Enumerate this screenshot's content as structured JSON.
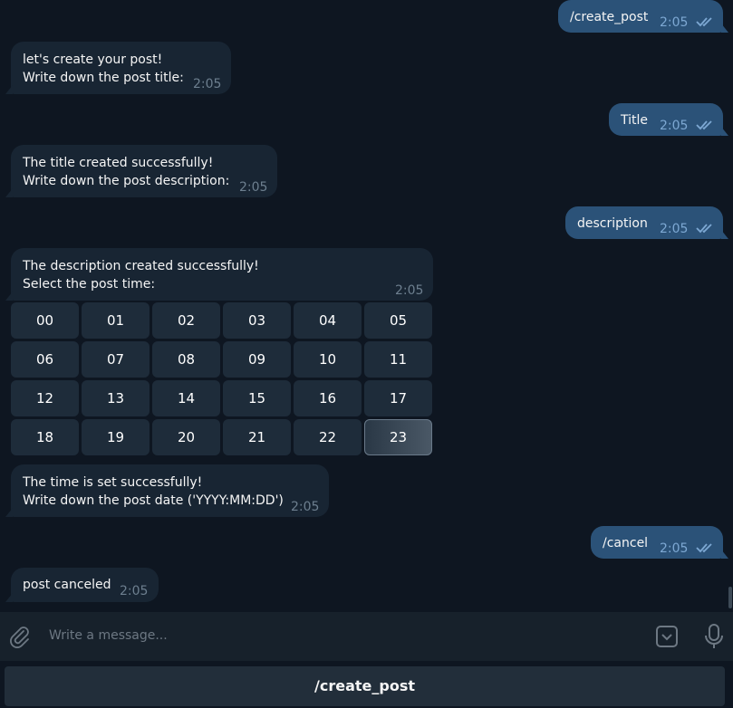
{
  "messages": [
    {
      "dir": "out",
      "text": "/create_post",
      "time": "2:05"
    },
    {
      "dir": "in",
      "text": "let's create your post!\nWrite down the post title:",
      "time": "2:05"
    },
    {
      "dir": "out",
      "text": "Title",
      "time": "2:05"
    },
    {
      "dir": "in",
      "text": "The title created successfully!\nWrite down the post description:",
      "time": "2:05"
    },
    {
      "dir": "out",
      "text": "description",
      "time": "2:05"
    },
    {
      "dir": "in",
      "text": "The description created successfully!\nSelect the post time:",
      "time": "2:05"
    },
    {
      "dir": "in",
      "text": "The time is set successfully!\nWrite down the post date ('YYYY:MM:DD')",
      "time": "2:05"
    },
    {
      "dir": "out",
      "text": "/cancel",
      "time": "2:05"
    },
    {
      "dir": "in",
      "text": "post canceled",
      "time": "2:05"
    }
  ],
  "time_keyboard": {
    "keys": [
      "00",
      "01",
      "02",
      "03",
      "04",
      "05",
      "06",
      "07",
      "08",
      "09",
      "10",
      "11",
      "12",
      "13",
      "14",
      "15",
      "16",
      "17",
      "18",
      "19",
      "20",
      "21",
      "22",
      "23"
    ],
    "selected": "23"
  },
  "composer": {
    "placeholder": "Write a message...",
    "icons": [
      "paperclip-icon",
      "bot-keyboard-icon",
      "microphone-icon"
    ]
  },
  "reply_keyboard": {
    "button_label": "/create_post"
  },
  "colors": {
    "background": "#0e1621",
    "incoming": "#182533",
    "outgoing": "#2b5278",
    "check": "#7da8d3"
  }
}
